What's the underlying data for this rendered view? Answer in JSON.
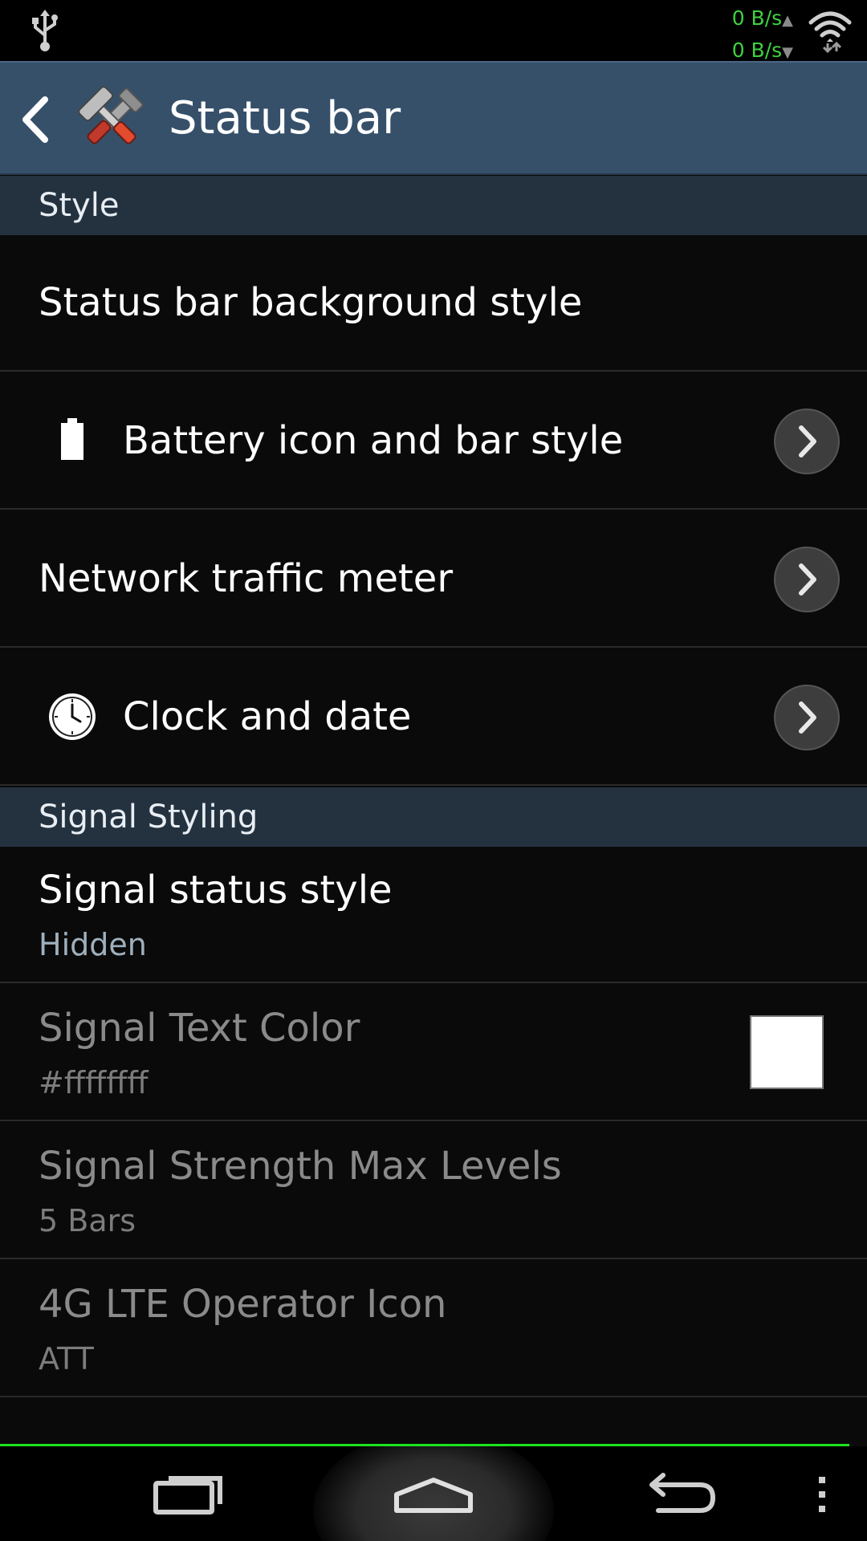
{
  "status_bar": {
    "traffic_up": "0 B/s",
    "traffic_down": "0 B/s",
    "traffic_color": "#3fd13f",
    "icons": [
      "usb-icon",
      "wifi-icon"
    ]
  },
  "action_bar": {
    "title": "Status bar",
    "icons": [
      "back-icon",
      "tools-icon"
    ],
    "background": "#36506a"
  },
  "sections": [
    {
      "header": "Style",
      "items": [
        {
          "label": "Status bar background style"
        },
        {
          "label": "Battery icon and bar style",
          "icon": "battery-icon",
          "has_chevron": true
        },
        {
          "label": "Network traffic meter",
          "has_chevron": true
        },
        {
          "label": "Clock and date",
          "icon": "clock-icon",
          "has_chevron": true
        }
      ]
    },
    {
      "header": "Signal Styling",
      "items": [
        {
          "label": "Signal status style",
          "summary": "Hidden",
          "enabled": true
        },
        {
          "label": "Signal Text Color",
          "summary": "#ffffffff",
          "enabled": false,
          "swatch_color": "#ffffff"
        },
        {
          "label": "Signal Strength Max Levels",
          "summary": "5 Bars",
          "enabled": false
        },
        {
          "label": "4G LTE Operator Icon",
          "summary": "ATT",
          "enabled": false
        }
      ]
    }
  ],
  "nav_bar": {
    "buttons": [
      "recent-apps-icon",
      "home-icon",
      "back-nav-icon",
      "overflow-menu-icon"
    ],
    "accent_line_color": "#1de31d"
  }
}
